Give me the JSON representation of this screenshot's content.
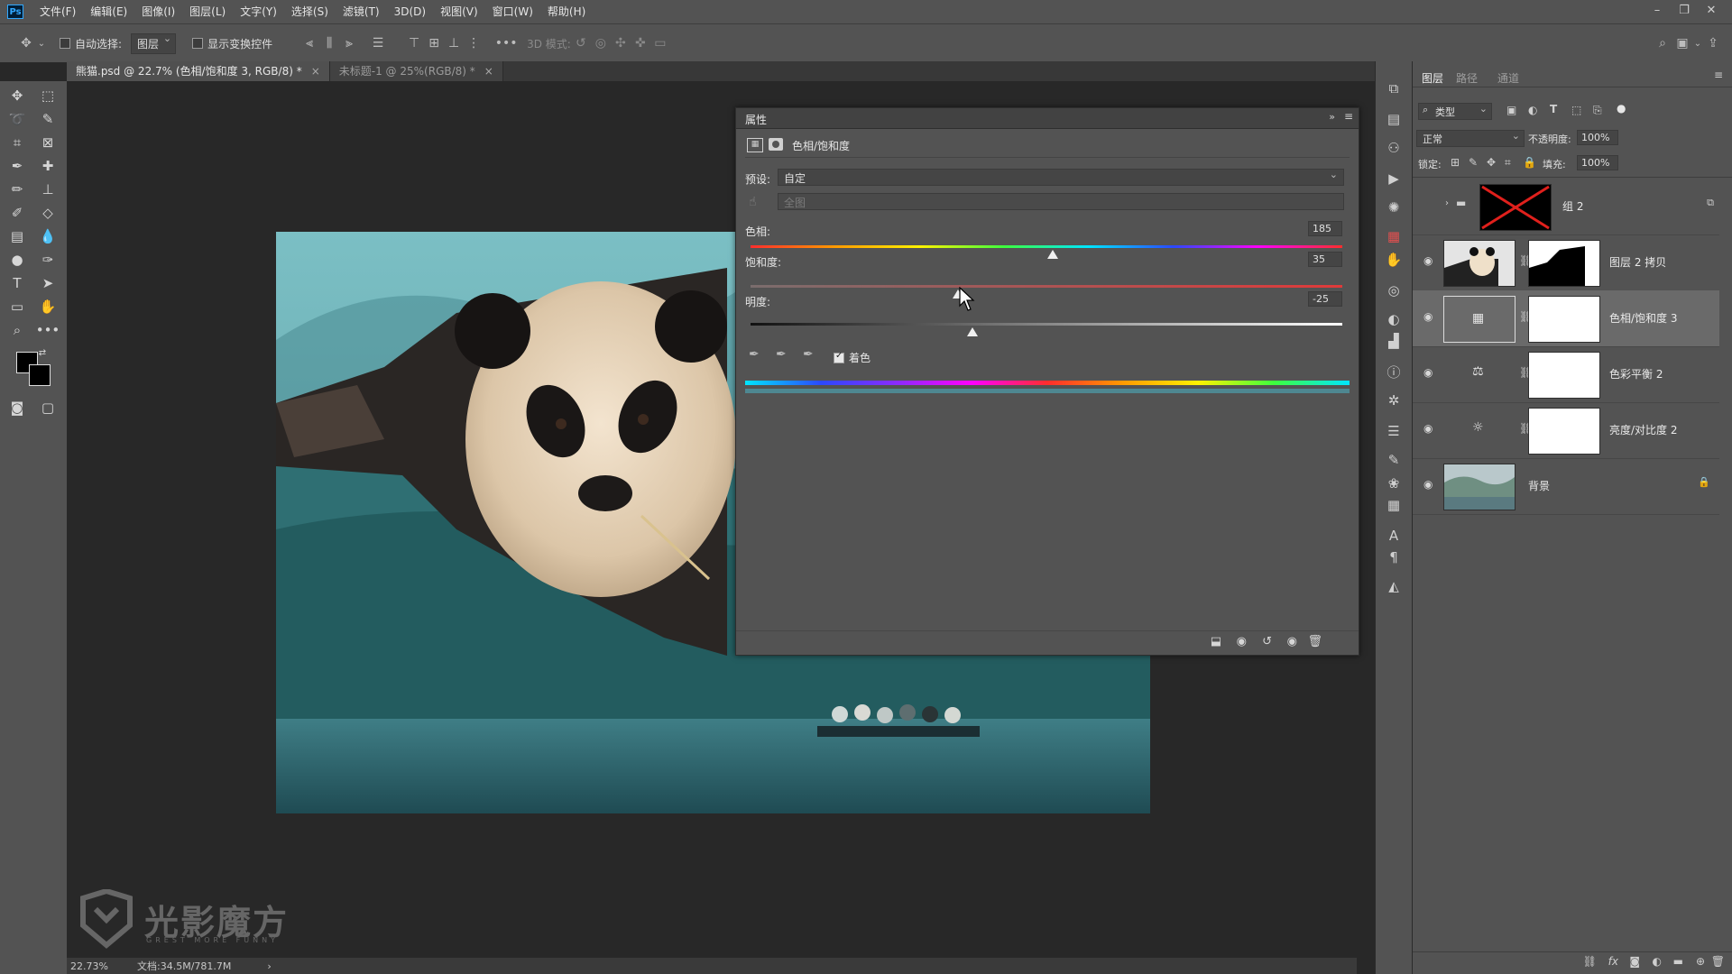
{
  "menubar": {
    "logo": "Ps",
    "items": [
      "文件(F)",
      "编辑(E)",
      "图像(I)",
      "图层(L)",
      "文字(Y)",
      "选择(S)",
      "滤镜(T)",
      "3D(D)",
      "视图(V)",
      "窗口(W)",
      "帮助(H)"
    ]
  },
  "options": {
    "auto_select_label": "自动选择:",
    "auto_select_value": "图层",
    "show_transform_label": "显示变换控件",
    "mode_3d_label": "3D 模式:"
  },
  "tabs": [
    {
      "label": "熊猫.psd @ 22.7% (色相/饱和度 3, RGB/8) *",
      "close": "×"
    },
    {
      "label": "未标题-1 @ 25%(RGB/8) *",
      "close": "×"
    }
  ],
  "properties": {
    "title": "属性",
    "header_label": "色相/饱和度",
    "preset_label": "预设:",
    "preset_value": "自定",
    "channel_value": "全图",
    "hue_label": "色相:",
    "hue_value": "185",
    "saturation_label": "饱和度:",
    "saturation_value": "35",
    "lightness_label": "明度:",
    "lightness_value": "-25",
    "colorize_label": "着色",
    "hue_position": 0.51,
    "saturation_position": 0.35,
    "lightness_position": 0.375
  },
  "layers_panel": {
    "tabs": [
      "图层",
      "路径",
      "通道"
    ],
    "filter_value": "类型",
    "blend_mode": "正常",
    "opacity_label": "不透明度:",
    "opacity_value": "100%",
    "lock_label": "锁定:",
    "fill_label": "填充:",
    "fill_value": "100%",
    "layers": [
      {
        "name": "组 2"
      },
      {
        "name": "图层 2 拷贝"
      },
      {
        "name": "色相/饱和度 3"
      },
      {
        "name": "色彩平衡 2"
      },
      {
        "name": "亮度/对比度 2"
      },
      {
        "name": "背景"
      }
    ]
  },
  "status": {
    "zoom": "22.73%",
    "doc": "文档:34.5M/781.7M",
    "arrow": "›"
  },
  "watermark": {
    "text": "光影魔方",
    "subtext": "GREST MORE FUNNY"
  }
}
